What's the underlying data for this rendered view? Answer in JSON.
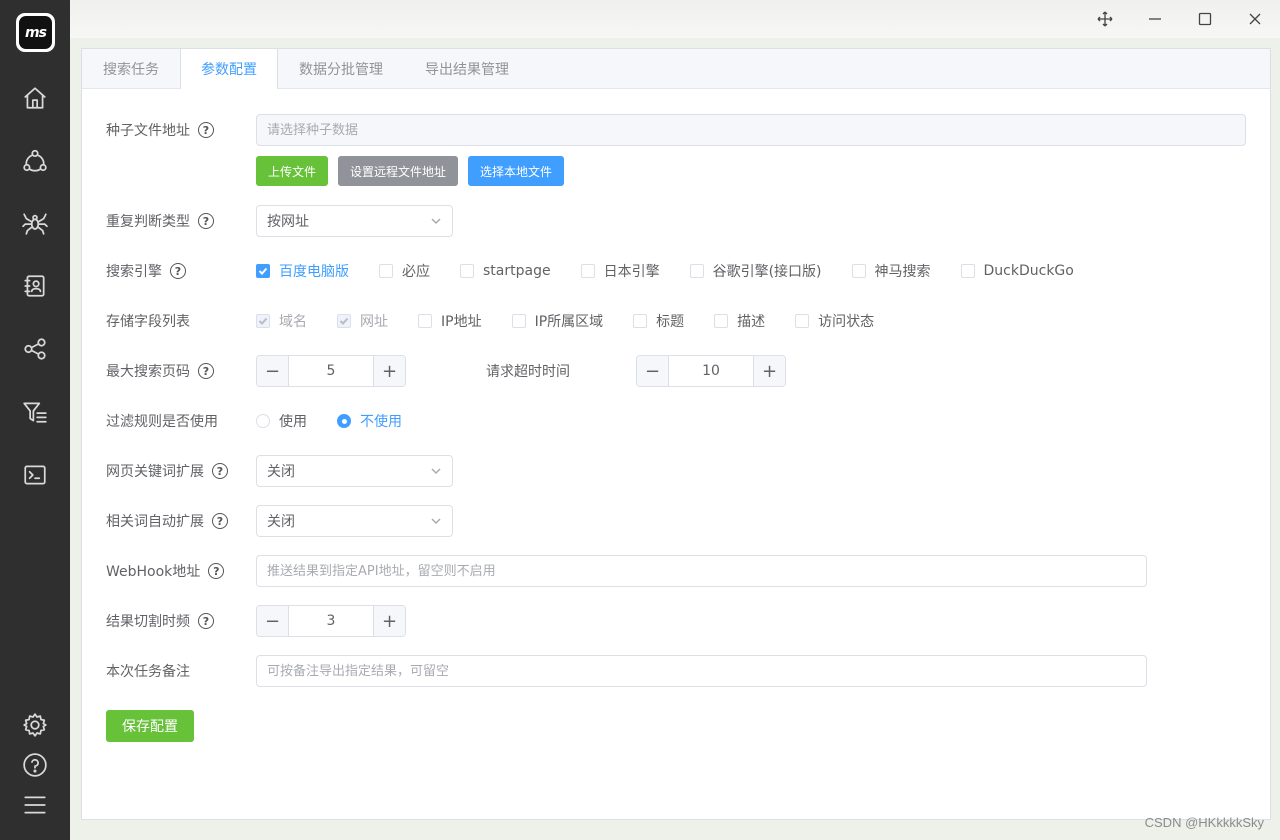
{
  "app": {
    "logo_text": "ms"
  },
  "sidebar": {
    "items": [
      {
        "name": "home",
        "icon": "home-icon"
      },
      {
        "name": "nodes",
        "icon": "nodes-icon"
      },
      {
        "name": "spider",
        "icon": "spider-icon"
      },
      {
        "name": "contacts",
        "icon": "contact-book-icon"
      },
      {
        "name": "share",
        "icon": "share-icon"
      },
      {
        "name": "filter",
        "icon": "filter-icon"
      },
      {
        "name": "terminal",
        "icon": "terminal-icon"
      }
    ],
    "bottom": [
      {
        "name": "settings",
        "icon": "gear-icon"
      },
      {
        "name": "help",
        "icon": "question-icon"
      },
      {
        "name": "menu",
        "icon": "menu-icon"
      }
    ]
  },
  "tabs": [
    {
      "label": "搜索任务",
      "active": false
    },
    {
      "label": "参数配置",
      "active": true
    },
    {
      "label": "数据分批管理",
      "active": false
    },
    {
      "label": "导出结果管理",
      "active": false
    }
  ],
  "form": {
    "seed_file": {
      "label": "种子文件地址",
      "placeholder": "请选择种子数据",
      "buttons": {
        "upload": "上传文件",
        "remote": "设置远程文件地址",
        "local": "选择本地文件"
      }
    },
    "dup_type": {
      "label": "重复判断类型",
      "value": "按网址"
    },
    "engines": {
      "label": "搜索引擎",
      "options": [
        {
          "label": "百度电脑版",
          "checked": true
        },
        {
          "label": "必应",
          "checked": false
        },
        {
          "label": "startpage",
          "checked": false
        },
        {
          "label": "日本引擎",
          "checked": false
        },
        {
          "label": "谷歌引擎(接口版)",
          "checked": false
        },
        {
          "label": "神马搜索",
          "checked": false
        },
        {
          "label": "DuckDuckGo",
          "checked": false
        }
      ]
    },
    "fields": {
      "label": "存储字段列表",
      "options": [
        {
          "label": "域名",
          "checked": true,
          "disabled": true
        },
        {
          "label": "网址",
          "checked": true,
          "disabled": true
        },
        {
          "label": "IP地址",
          "checked": false,
          "disabled": false
        },
        {
          "label": "IP所属区域",
          "checked": false,
          "disabled": false
        },
        {
          "label": "标题",
          "checked": false,
          "disabled": false
        },
        {
          "label": "描述",
          "checked": false,
          "disabled": false
        },
        {
          "label": "访问状态",
          "checked": false,
          "disabled": false
        }
      ]
    },
    "max_pages": {
      "label": "最大搜索页码",
      "value": "5"
    },
    "timeout": {
      "label": "请求超时时间",
      "value": "10"
    },
    "filter_rules": {
      "label": "过滤规则是否使用",
      "options": [
        {
          "label": "使用",
          "checked": false
        },
        {
          "label": "不使用",
          "checked": true
        }
      ]
    },
    "keyword_expand": {
      "label": "网页关键词扩展",
      "value": "关闭"
    },
    "related_expand": {
      "label": "相关词自动扩展",
      "value": "关闭"
    },
    "webhook": {
      "label": "WebHook地址",
      "placeholder": "推送结果到指定API地址，留空则不启用"
    },
    "cut_freq": {
      "label": "结果切割时频",
      "value": "3"
    },
    "note": {
      "label": "本次任务备注",
      "placeholder": "可按备注导出指定结果，可留空"
    },
    "save_label": "保存配置"
  },
  "watermark": "CSDN @HKkkkkSky",
  "colors": {
    "accent": "#409eff",
    "success": "#67c23a",
    "sidebar": "#2f2f2f"
  }
}
